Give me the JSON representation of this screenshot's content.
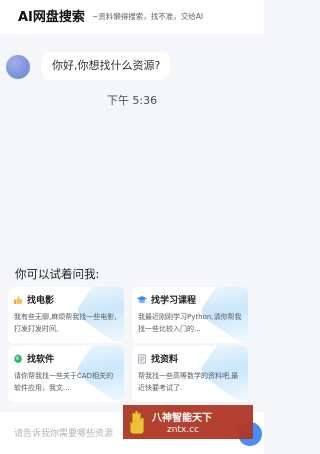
{
  "header": {
    "title": "AI网盘搜索",
    "tagline": "~资料懒得搜索，找不准，交给AI"
  },
  "chat": {
    "greeting": "你好,你想找什么资源?",
    "timestamp": "下午 5:36"
  },
  "suggestions": {
    "title": "你可以试着问我:",
    "cards": [
      {
        "title": "找电影",
        "desc": "我有些无聊,麻烦帮我找一些电影,打发打发时间,",
        "icon": "thumbs-up-icon",
        "icon_color": "#f2a93b"
      },
      {
        "title": "找学习课程",
        "desc": "我最近刚刚学习Python,请你帮我找一些比较入门的...",
        "icon": "graduation-cap-icon",
        "icon_color": "#3a8ee6"
      },
      {
        "title": "找软件",
        "desc": "请你帮我找一些关于CAD相关的软件应用，我文...",
        "icon": "leaf-icon",
        "icon_color": "#2fb36b"
      },
      {
        "title": "找资料",
        "desc": "帮我找一些高等数学的资料吧,最近快要考试了.",
        "icon": "document-icon",
        "icon_color": "#9aa3ad"
      }
    ]
  },
  "input": {
    "placeholder": "请告诉我你需要哪些资源"
  },
  "watermark": {
    "text": "八神智能天下",
    "url": "zntx.cc"
  },
  "colors": {
    "accent": "#4a8df6",
    "background": "#f4f6f9",
    "watermark": "#b03724"
  }
}
